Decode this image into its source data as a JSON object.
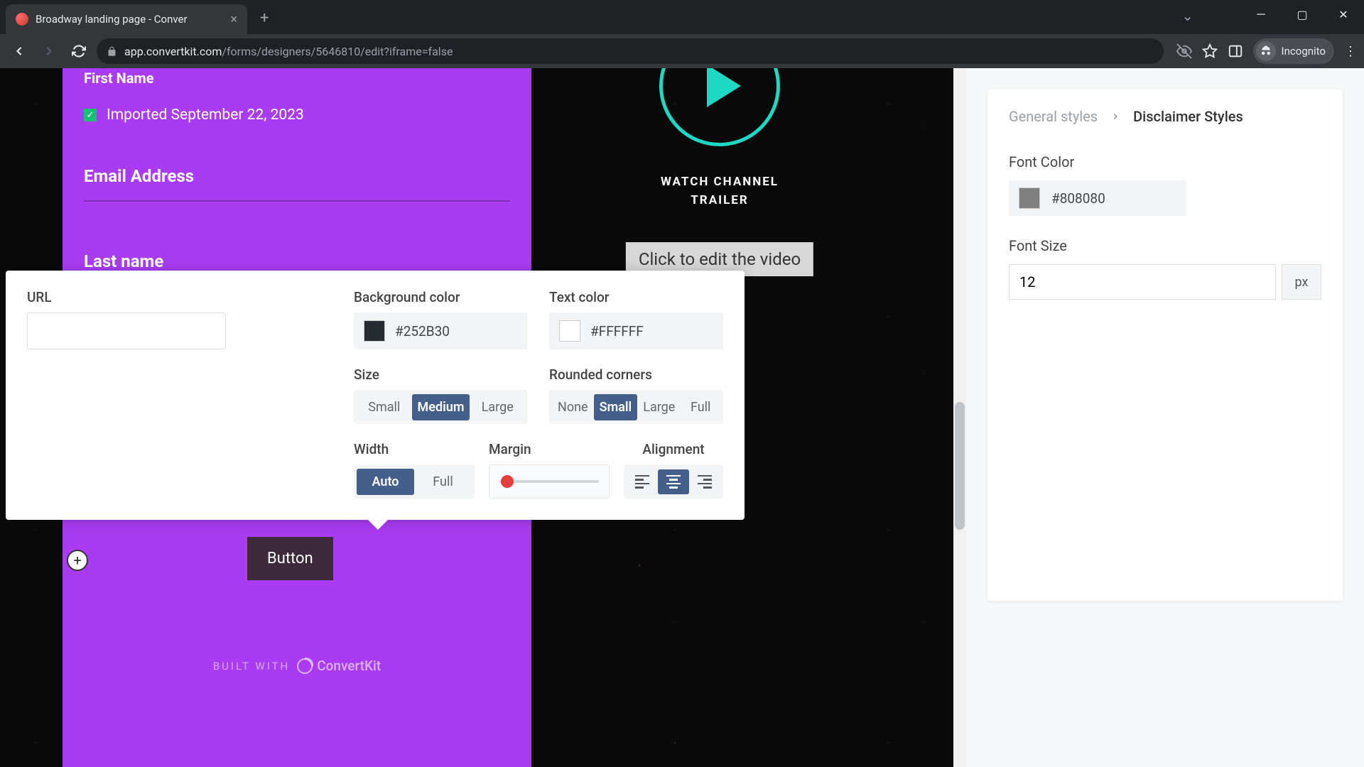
{
  "browser": {
    "tab_title": "Broadway landing page - Conver",
    "url_host": "app.convertkit.com",
    "url_path": "/forms/designers/5646810/edit?iframe=false",
    "incognito_label": "Incognito"
  },
  "form": {
    "first_name_label": "First Name",
    "imported_text": "Imported September 22, 2023",
    "email_label": "Email Address",
    "last_name_label": "Last name",
    "button_text": "Button",
    "built_with": "BUILT WITH",
    "brand": "ConvertKit"
  },
  "video": {
    "watch_line1": "WATCH CHANNEL",
    "watch_line2": "TRAILER",
    "tooltip": "Click to edit the video"
  },
  "popover": {
    "url_label": "URL",
    "bg_label": "Background color",
    "bg_value": "#252B30",
    "text_label": "Text color",
    "text_value": "#FFFFFF",
    "size_label": "Size",
    "size_options": {
      "small": "Small",
      "medium": "Medium",
      "large": "Large"
    },
    "corners_label": "Rounded corners",
    "corners_options": {
      "none": "None",
      "small": "Small",
      "large": "Large",
      "full": "Full"
    },
    "width_label": "Width",
    "width_options": {
      "auto": "Auto",
      "full": "Full"
    },
    "margin_label": "Margin",
    "alignment_label": "Alignment"
  },
  "sidebar": {
    "breadcrumb_root": "General styles",
    "breadcrumb_current": "Disclaimer Styles",
    "font_color_label": "Font Color",
    "font_color_value": "#808080",
    "font_size_label": "Font Size",
    "font_size_value": "12",
    "font_size_unit": "px"
  },
  "colors": {
    "bg_swatch": "#252B30",
    "text_swatch": "#FFFFFF",
    "font_swatch": "#808080"
  }
}
